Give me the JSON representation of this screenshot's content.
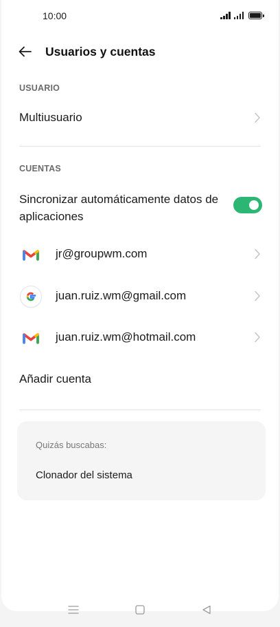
{
  "status_bar": {
    "time": "10:00"
  },
  "header": {
    "title": "Usuarios y cuentas"
  },
  "sections": {
    "user_label": "USUARIO",
    "accounts_label": "CUENTAS"
  },
  "user": {
    "multiuser_label": "Multiusuario"
  },
  "sync": {
    "label": "Sincronizar automáticamente datos de aplicaciones",
    "enabled": true
  },
  "accounts": [
    {
      "email": "jr@groupwm.com",
      "icon": "gmail-icon"
    },
    {
      "email": "juan.ruiz.wm@gmail.com",
      "icon": "google-icon"
    },
    {
      "email": "juan.ruiz.wm@hotmail.com",
      "icon": "gmail-icon"
    }
  ],
  "add_account_label": "Añadir cuenta",
  "suggestions": {
    "title": "Quizás buscabas:",
    "item": "Clonador del sistema"
  },
  "colors": {
    "toggle_on": "#2bb673",
    "gmail_red": "#ea4335",
    "google_blue": "#4285f4",
    "google_yellow": "#fbbc05",
    "google_green": "#34a853"
  }
}
